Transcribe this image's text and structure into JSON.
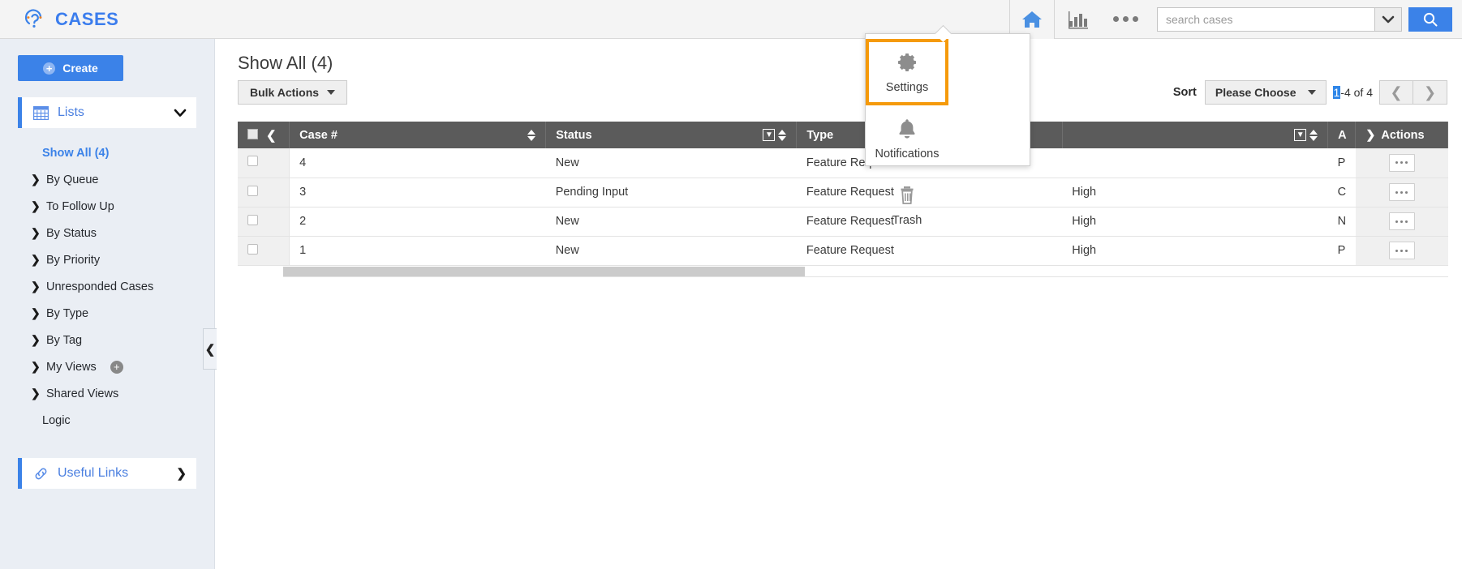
{
  "header": {
    "brand": "CASES",
    "brand_logo_icon": "question-mark-listen-logo",
    "home_icon": "home-icon",
    "chart_icon": "bar-chart-icon",
    "more_icon": "ellipsis-icon",
    "search_placeholder": "search cases",
    "search_value": "",
    "search_dropdown_icon": "chevron-down-icon",
    "search_button_icon": "search-icon",
    "accent_color": "#3b82e8"
  },
  "more_menu": {
    "items": [
      {
        "label": "Settings",
        "icon": "gear-icon",
        "selected": true
      },
      {
        "label": "Notifications",
        "icon": "bell-icon",
        "selected": false
      },
      {
        "label": "Trash",
        "icon": "trash-icon",
        "selected": false
      }
    ],
    "highlight_color": "#f59a0b"
  },
  "sidebar": {
    "create_label": "Create",
    "create_icon": "plus-circle-icon",
    "panel": {
      "label": "Lists",
      "icon": "grid-icon",
      "expand_icon": "chevron-down-icon"
    },
    "items": [
      {
        "label": "Show All (4)",
        "style": "active",
        "has_arrow": false
      },
      {
        "label": "By Queue",
        "style": "normal",
        "has_arrow": true
      },
      {
        "label": "To Follow Up",
        "style": "normal",
        "has_arrow": true
      },
      {
        "label": "By Status",
        "style": "normal",
        "has_arrow": true
      },
      {
        "label": "By Priority",
        "style": "normal",
        "has_arrow": true
      },
      {
        "label": "Unresponded Cases",
        "style": "normal",
        "has_arrow": true
      },
      {
        "label": "By Type",
        "style": "normal",
        "has_arrow": true
      },
      {
        "label": "By Tag",
        "style": "normal",
        "has_arrow": true
      },
      {
        "label": "My Views",
        "style": "normal",
        "has_arrow": true,
        "add_icon": "plus-circle-icon"
      },
      {
        "label": "Shared Views",
        "style": "normal",
        "has_arrow": true
      },
      {
        "label": "Logic",
        "style": "plain",
        "has_arrow": false
      }
    ],
    "useful_links": {
      "label": "Useful Links",
      "icon": "link-icon",
      "expand_icon": "chevron-right-icon"
    },
    "collapse_icon": "chevron-left-icon"
  },
  "main": {
    "title": "Show All (4)",
    "bulk_actions_label": "Bulk Actions",
    "bulk_actions_icon": "caret-down-icon",
    "sort_label": "Sort",
    "sort_value": "Please Choose",
    "sort_icon": "caret-down-icon",
    "pager": {
      "current": "1",
      "range_suffix": "-4 of 4",
      "prev_icon": "chevron-left-icon",
      "next_icon": "chevron-right-icon"
    }
  },
  "table": {
    "select_all_icon": "checkbox-unchecked-icon",
    "collapse_col_icon": "chevron-left-icon",
    "columns": [
      {
        "label": "Case #",
        "sortable": true,
        "filterable": false
      },
      {
        "label": "Status",
        "sortable": true,
        "filterable": true
      },
      {
        "label": "Type",
        "sortable": false,
        "filterable": false
      },
      {
        "label": "",
        "sortable": true,
        "filterable": true
      },
      {
        "label": "A",
        "sortable": false,
        "filterable": false
      },
      {
        "label": "Actions",
        "sortable": false,
        "filterable": false,
        "prefix_icon": "chevron-right-icon"
      }
    ],
    "rows": [
      {
        "case": "4",
        "status": "New",
        "type": "Feature Request",
        "priority": "",
        "extra": "P",
        "actions_icon": "ellipsis-icon"
      },
      {
        "case": "3",
        "status": "Pending Input",
        "type": "Feature Request",
        "priority": "High",
        "extra": "C",
        "actions_icon": "ellipsis-icon"
      },
      {
        "case": "2",
        "status": "New",
        "type": "Feature Request",
        "priority": "High",
        "extra": "N",
        "actions_icon": "ellipsis-icon"
      },
      {
        "case": "1",
        "status": "New",
        "type": "Feature Request",
        "priority": "High",
        "extra": "P",
        "actions_icon": "ellipsis-icon"
      }
    ]
  }
}
